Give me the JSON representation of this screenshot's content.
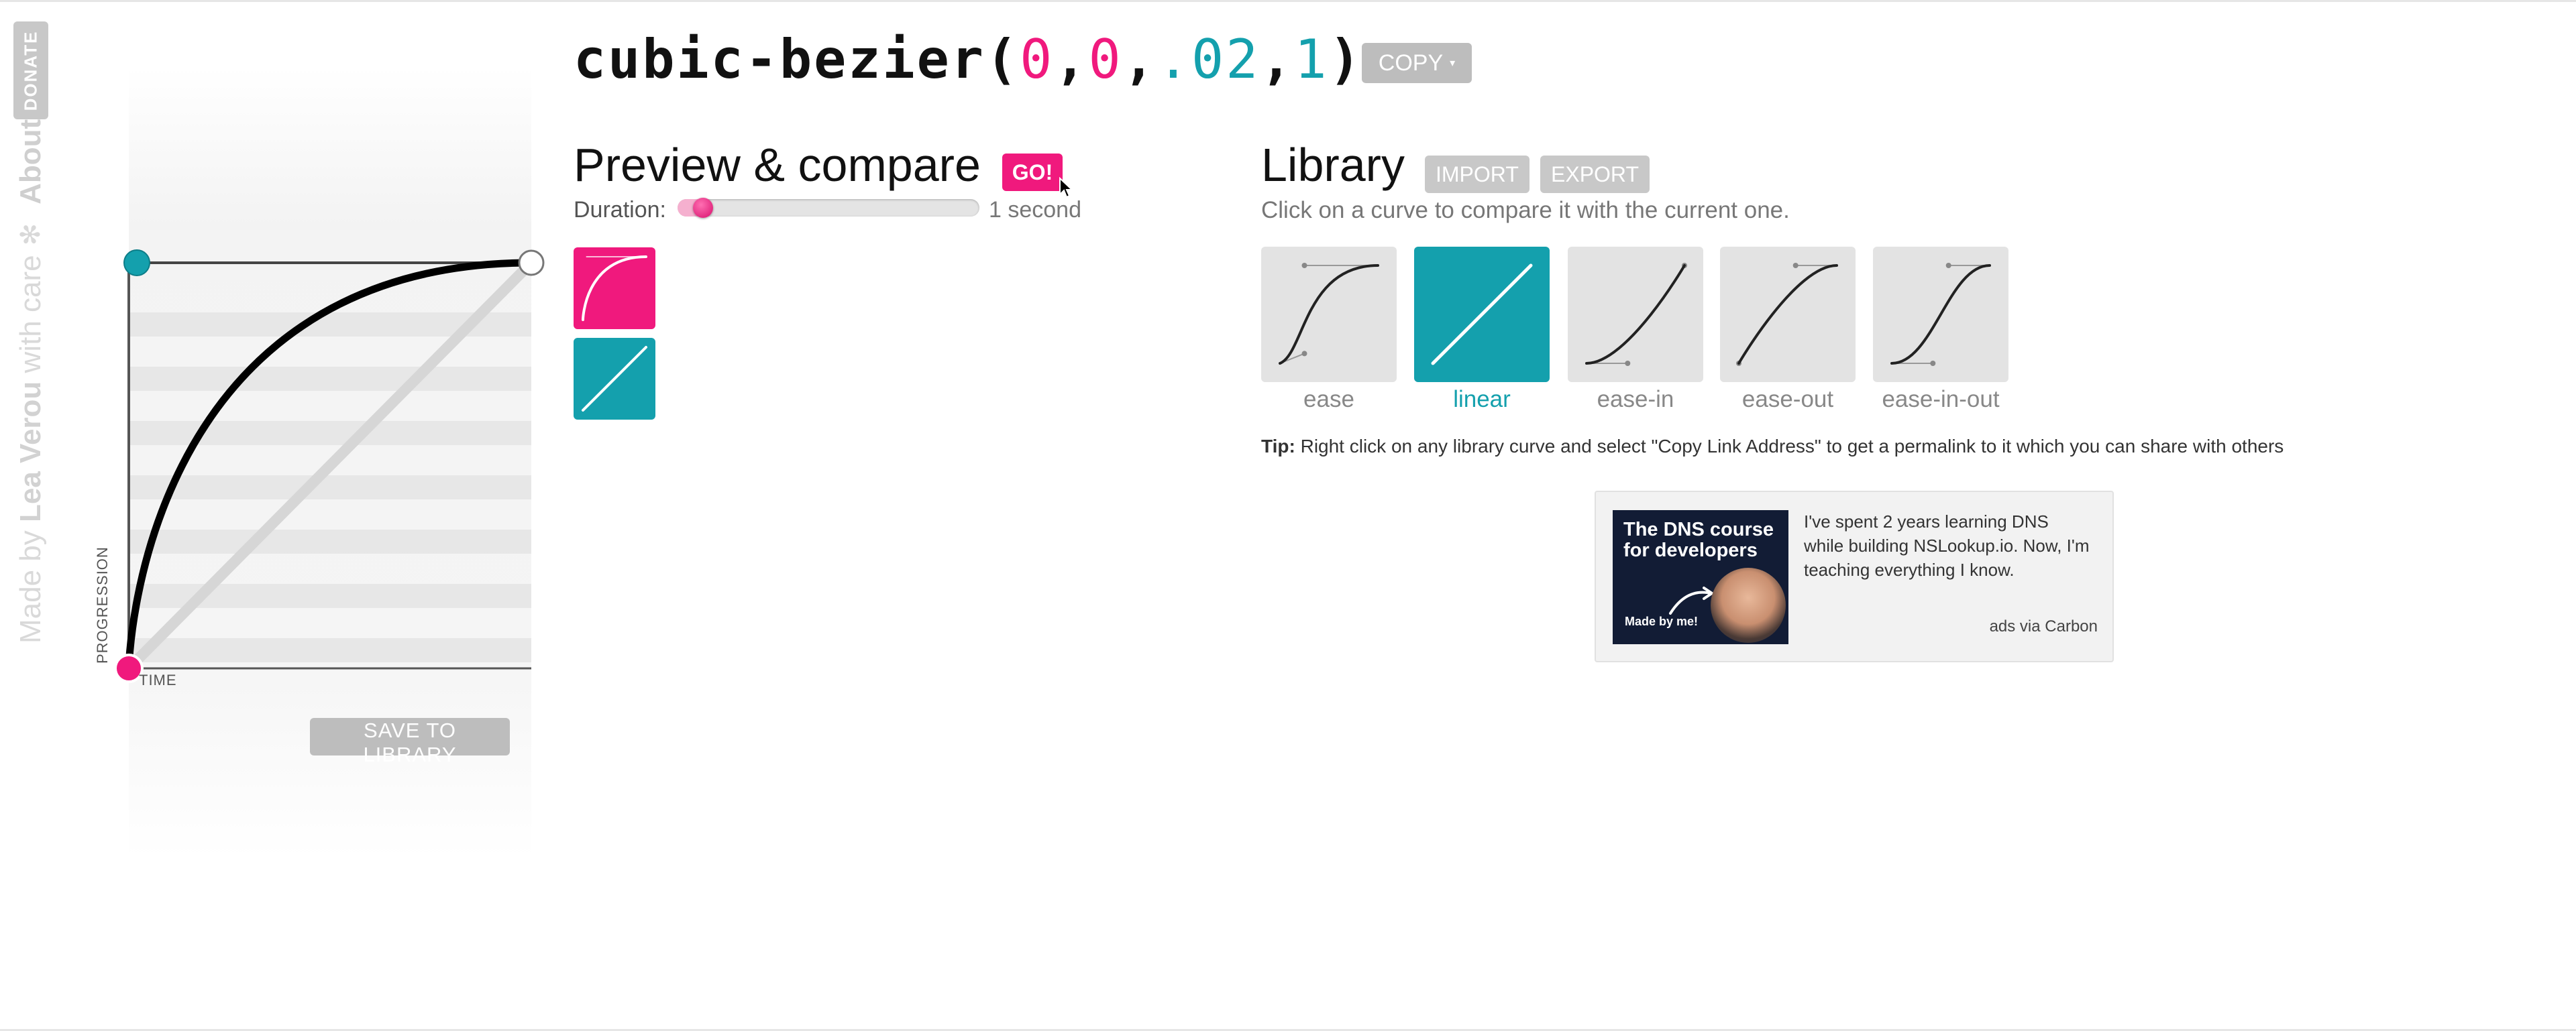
{
  "sidebar": {
    "donate_label": "DONATE",
    "made_by": "Made by",
    "author": "Lea Verou",
    "with_care": "with care",
    "star": "✻",
    "about_label": "About"
  },
  "header": {
    "prefix": "cubic-bezier(",
    "p1": "0",
    "sep1": ",",
    "p2": "0",
    "sep2": ",",
    "p3": ".02",
    "sep3": ",",
    "p4": "1",
    "suffix": ")",
    "copy_label": "COPY",
    "copy_arrow": "▾"
  },
  "editor": {
    "progression_label": "PROGRESSION",
    "time_label": "TIME",
    "save_label": "SAVE TO LIBRARY",
    "curve": [
      0,
      0,
      0.02,
      1
    ],
    "colors": {
      "p1_handle": "#14a0ad",
      "start_point": "#f0197d",
      "curve": "#000000",
      "reference": "#d6d6d6"
    }
  },
  "preview": {
    "title": "Preview & compare",
    "go_label": "GO!",
    "duration_label": "Duration:",
    "duration_value": "1 second",
    "duration_fraction": 0.05,
    "boxes": [
      {
        "name": "current",
        "color": "#f0197d",
        "curve": [
          0,
          0,
          0.02,
          1
        ]
      },
      {
        "name": "linear",
        "color": "#14a0ad",
        "curve": [
          0,
          0,
          1,
          1
        ]
      }
    ]
  },
  "library": {
    "title": "Library",
    "import_label": "IMPORT",
    "export_label": "EXPORT",
    "subtitle": "Click on a curve to compare it with the current one.",
    "items": [
      {
        "name": "ease",
        "curve": [
          0.25,
          0.1,
          0.25,
          1
        ],
        "active": false
      },
      {
        "name": "linear",
        "curve": [
          0,
          0,
          1,
          1
        ],
        "active": true
      },
      {
        "name": "ease-in",
        "curve": [
          0.42,
          0,
          1,
          1
        ],
        "active": false
      },
      {
        "name": "ease-out",
        "curve": [
          0,
          0,
          0.58,
          1
        ],
        "active": false
      },
      {
        "name": "ease-in-out",
        "curve": [
          0.42,
          0,
          0.58,
          1
        ],
        "active": false
      }
    ],
    "tip_label": "Tip:",
    "tip_text": " Right click on any library curve and select \"Copy Link Address\" to get a permalink to it which you can share with others"
  },
  "ad": {
    "image_title": "The DNS course for developers",
    "image_caption": "Made by me!",
    "text": "I've spent 2 years learning DNS while building NSLookup.io. Now, I'm teaching everything I know.",
    "via": "ads via Carbon"
  },
  "colors": {
    "accent_pink": "#f0197d",
    "accent_teal": "#14a0ad",
    "button_gray": "#bdbdbd"
  }
}
